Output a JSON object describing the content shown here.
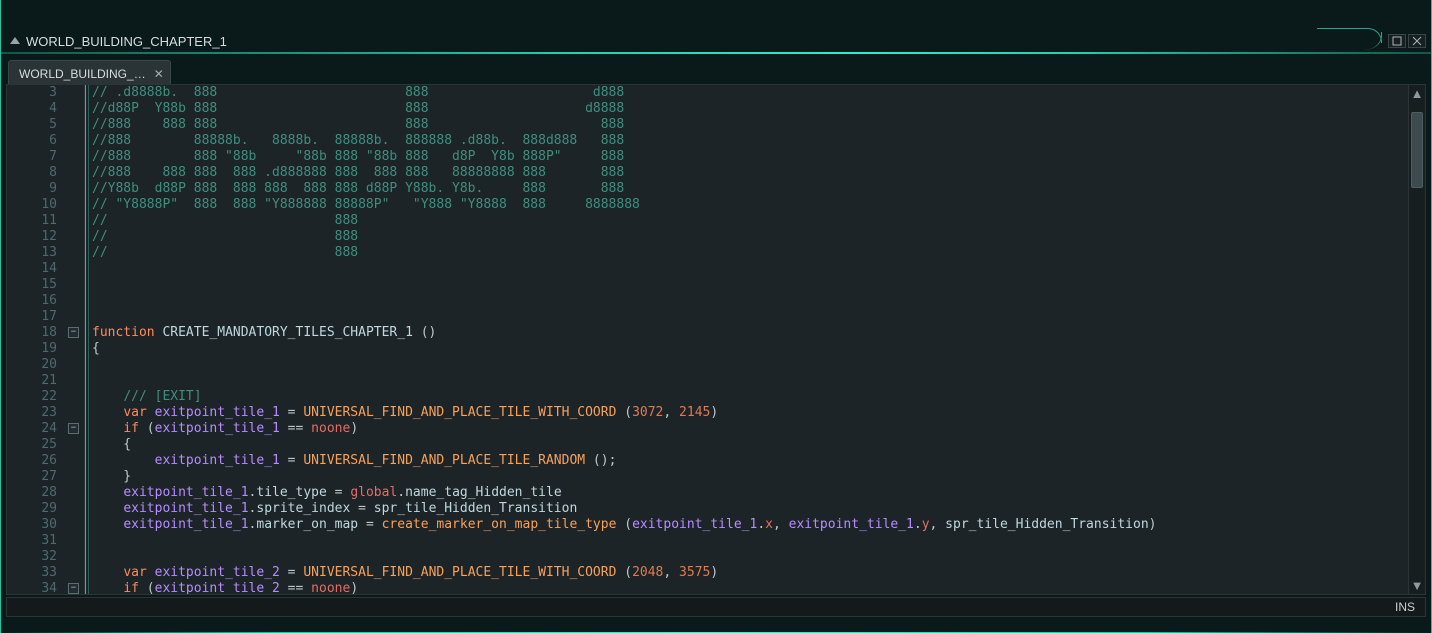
{
  "window": {
    "title": "WORLD_BUILDING_CHAPTER_1"
  },
  "tabs": [
    {
      "label": "WORLD_BUILDING_…"
    }
  ],
  "status": {
    "mode": "INS"
  },
  "scrollbar": {
    "thumb_top_pct": 2,
    "thumb_height_pct": 16
  },
  "fold_marks": [
    {
      "line": 18,
      "glyph": "−"
    },
    {
      "line": 24,
      "glyph": "−"
    },
    {
      "line": 34,
      "glyph": "−"
    }
  ],
  "code": {
    "first_line_number": 3,
    "lines": [
      [
        [
          "c-comment",
          "// .d8888b.  888                        888                     d888  "
        ]
      ],
      [
        [
          "c-comment",
          "//d88P  Y88b 888                        888                    d8888  "
        ]
      ],
      [
        [
          "c-comment",
          "//888    888 888                        888                      888  "
        ]
      ],
      [
        [
          "c-comment",
          "//888        88888b.   8888b.  88888b.  888888 .d88b.  888d888   888  "
        ]
      ],
      [
        [
          "c-comment",
          "//888        888 \"88b     \"88b 888 \"88b 888   d8P  Y8b 888P\"     888  "
        ]
      ],
      [
        [
          "c-comment",
          "//888    888 888  888 .d888888 888  888 888   88888888 888       888  "
        ]
      ],
      [
        [
          "c-comment",
          "//Y88b  d88P 888  888 888  888 888 d88P Y88b. Y8b.     888       888  "
        ]
      ],
      [
        [
          "c-comment",
          "// \"Y8888P\"  888  888 \"Y888888 88888P\"   \"Y888 \"Y8888  888     8888888"
        ]
      ],
      [
        [
          "c-comment",
          "//                             888                                      "
        ]
      ],
      [
        [
          "c-comment",
          "//                             888                                      "
        ]
      ],
      [
        [
          "c-comment",
          "//                             888                                      "
        ]
      ],
      [],
      [],
      [],
      [],
      [
        [
          "c-kw",
          "function"
        ],
        [
          "c-op",
          " "
        ],
        [
          "c-ident",
          "CREATE_MANDATORY_TILES_CHAPTER_1"
        ],
        [
          "c-op",
          " ()"
        ]
      ],
      [
        [
          "c-op",
          "{"
        ]
      ],
      [],
      [],
      [
        [
          "c-op",
          "    "
        ],
        [
          "c-comment",
          "/// [EXIT]"
        ]
      ],
      [
        [
          "c-op",
          "    "
        ],
        [
          "c-kw",
          "var"
        ],
        [
          "c-op",
          " "
        ],
        [
          "c-var",
          "exitpoint_tile_1"
        ],
        [
          "c-op",
          " = "
        ],
        [
          "c-fn",
          "UNIVERSAL_FIND_AND_PLACE_TILE_WITH_COORD"
        ],
        [
          "c-op",
          " ("
        ],
        [
          "c-num",
          "3072"
        ],
        [
          "c-op",
          ", "
        ],
        [
          "c-num",
          "2145"
        ],
        [
          "c-op",
          ")"
        ]
      ],
      [
        [
          "c-op",
          "    "
        ],
        [
          "c-kw",
          "if"
        ],
        [
          "c-op",
          " ("
        ],
        [
          "c-var",
          "exitpoint_tile_1"
        ],
        [
          "c-op",
          " == "
        ],
        [
          "c-red",
          "noone"
        ],
        [
          "c-op",
          ")"
        ]
      ],
      [
        [
          "c-op",
          "    {"
        ]
      ],
      [
        [
          "c-op",
          "        "
        ],
        [
          "c-var",
          "exitpoint_tile_1"
        ],
        [
          "c-op",
          " = "
        ],
        [
          "c-fn",
          "UNIVERSAL_FIND_AND_PLACE_TILE_RANDOM"
        ],
        [
          "c-op",
          " ();"
        ]
      ],
      [
        [
          "c-op",
          "    }"
        ]
      ],
      [
        [
          "c-op",
          "    "
        ],
        [
          "c-var",
          "exitpoint_tile_1"
        ],
        [
          "c-dot",
          "."
        ],
        [
          "c-ident",
          "tile_type"
        ],
        [
          "c-op",
          " = "
        ],
        [
          "c-red",
          "global"
        ],
        [
          "c-dot",
          "."
        ],
        [
          "c-ident",
          "name_tag_Hidden_tile"
        ]
      ],
      [
        [
          "c-op",
          "    "
        ],
        [
          "c-var",
          "exitpoint_tile_1"
        ],
        [
          "c-dot",
          "."
        ],
        [
          "c-ident",
          "sprite_index"
        ],
        [
          "c-op",
          " = "
        ],
        [
          "c-ident",
          "spr_tile_Hidden_Transition"
        ]
      ],
      [
        [
          "c-op",
          "    "
        ],
        [
          "c-var",
          "exitpoint_tile_1"
        ],
        [
          "c-dot",
          "."
        ],
        [
          "c-ident",
          "marker_on_map"
        ],
        [
          "c-op",
          " = "
        ],
        [
          "c-fn",
          "create_marker_on_map_tile_type"
        ],
        [
          "c-op",
          " ("
        ],
        [
          "c-var",
          "exitpoint_tile_1"
        ],
        [
          "c-dot",
          "."
        ],
        [
          "c-red",
          "x"
        ],
        [
          "c-op",
          ", "
        ],
        [
          "c-var",
          "exitpoint_tile_1"
        ],
        [
          "c-dot",
          "."
        ],
        [
          "c-red",
          "y"
        ],
        [
          "c-op",
          ", "
        ],
        [
          "c-ident",
          "spr_tile_Hidden_Transition"
        ],
        [
          "c-op",
          ")"
        ]
      ],
      [],
      [],
      [
        [
          "c-op",
          "    "
        ],
        [
          "c-kw",
          "var"
        ],
        [
          "c-op",
          " "
        ],
        [
          "c-var",
          "exitpoint_tile_2"
        ],
        [
          "c-op",
          " = "
        ],
        [
          "c-fn",
          "UNIVERSAL_FIND_AND_PLACE_TILE_WITH_COORD"
        ],
        [
          "c-op",
          " ("
        ],
        [
          "c-num",
          "2048"
        ],
        [
          "c-op",
          ", "
        ],
        [
          "c-num",
          "3575"
        ],
        [
          "c-op",
          ")"
        ]
      ],
      [
        [
          "c-op",
          "    "
        ],
        [
          "c-kw",
          "if"
        ],
        [
          "c-op",
          " ("
        ],
        [
          "c-var",
          "exitpoint_tile_2"
        ],
        [
          "c-op",
          " == "
        ],
        [
          "c-red",
          "noone"
        ],
        [
          "c-op",
          ")"
        ]
      ],
      [
        [
          "c-op",
          "    {"
        ]
      ]
    ]
  }
}
